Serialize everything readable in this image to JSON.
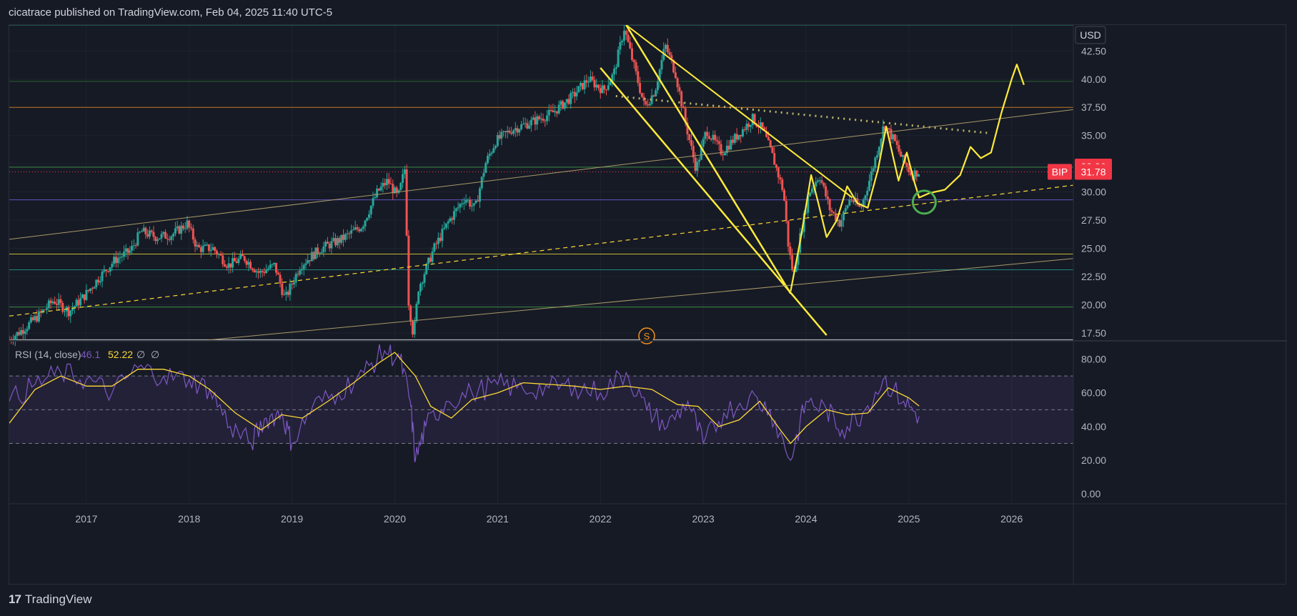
{
  "header": {
    "text": "cicatrace published on TradingView.com, Feb 04, 2025 11:40 UTC-5"
  },
  "footer": {
    "brand": "TradingView",
    "logo_glyph": "17"
  },
  "currency_label": "USD",
  "price_tags": [
    {
      "label": "32.26",
      "value": 32.26,
      "color": "#f23645"
    },
    {
      "label": "31.78",
      "value": 31.78,
      "color": "#f23645",
      "symbol": "BIP"
    }
  ],
  "event_marker": {
    "label": "S",
    "year": 2022.45,
    "color": "#f7931a"
  },
  "colors": {
    "background": "#161a25",
    "up": "#26a69a",
    "down": "#ef5350",
    "drawing_yellow": "#ffeb3b",
    "rsi": "#7e57c2",
    "rsi_ma": "#fdd835",
    "circle": "#4caf50"
  },
  "chart_data": [
    {
      "type": "candlestick",
      "symbol": "BIP",
      "currency": "USD",
      "x_axis": {
        "ticks": [
          "2017",
          "2018",
          "2019",
          "2020",
          "2021",
          "2022",
          "2023",
          "2024",
          "2025",
          "2026"
        ],
        "range": [
          2016.25,
          2026.6
        ]
      },
      "y_axis": {
        "ticks": [
          "17.50",
          "20.00",
          "22.50",
          "25.00",
          "27.50",
          "30.00",
          "32.50",
          "35.00",
          "37.50",
          "40.00",
          "42.50"
        ],
        "range": [
          16.8,
          44.8
        ]
      },
      "last_price": 31.78,
      "price_path": [
        [
          2016.25,
          16.8
        ],
        [
          2016.4,
          17.8
        ],
        [
          2016.55,
          19.0
        ],
        [
          2016.7,
          20.4
        ],
        [
          2016.85,
          19.4
        ],
        [
          2017.0,
          20.8
        ],
        [
          2017.15,
          22.5
        ],
        [
          2017.3,
          24.0
        ],
        [
          2017.45,
          24.8
        ],
        [
          2017.55,
          26.5
        ],
        [
          2017.7,
          26.0
        ],
        [
          2017.85,
          26.2
        ],
        [
          2018.0,
          27.2
        ],
        [
          2018.1,
          25.0
        ],
        [
          2018.25,
          25.0
        ],
        [
          2018.4,
          23.5
        ],
        [
          2018.55,
          24.2
        ],
        [
          2018.7,
          22.8
        ],
        [
          2018.85,
          23.5
        ],
        [
          2018.95,
          20.5
        ],
        [
          2019.1,
          23.5
        ],
        [
          2019.3,
          25.0
        ],
        [
          2019.5,
          25.8
        ],
        [
          2019.7,
          27.0
        ],
        [
          2019.85,
          30.0
        ],
        [
          2019.95,
          31.0
        ],
        [
          2020.05,
          29.5
        ],
        [
          2020.12,
          32.2
        ],
        [
          2020.15,
          20.5
        ],
        [
          2020.2,
          17.2
        ],
        [
          2020.25,
          21.5
        ],
        [
          2020.4,
          25.0
        ],
        [
          2020.55,
          27.5
        ],
        [
          2020.7,
          29.5
        ],
        [
          2020.8,
          28.5
        ],
        [
          2020.9,
          32.5
        ],
        [
          2021.0,
          34.5
        ],
        [
          2021.15,
          35.5
        ],
        [
          2021.35,
          36.2
        ],
        [
          2021.55,
          37.0
        ],
        [
          2021.75,
          38.5
        ],
        [
          2021.9,
          40.0
        ],
        [
          2022.05,
          39.0
        ],
        [
          2022.15,
          40.5
        ],
        [
          2022.25,
          44.5
        ],
        [
          2022.35,
          41.0
        ],
        [
          2022.45,
          37.5
        ],
        [
          2022.55,
          39.0
        ],
        [
          2022.65,
          43.0
        ],
        [
          2022.75,
          40.5
        ],
        [
          2022.85,
          36.0
        ],
        [
          2022.95,
          32.0
        ],
        [
          2023.05,
          35.5
        ],
        [
          2023.2,
          33.5
        ],
        [
          2023.35,
          35.0
        ],
        [
          2023.5,
          36.5
        ],
        [
          2023.6,
          35.5
        ],
        [
          2023.7,
          33.0
        ],
        [
          2023.8,
          30.0
        ],
        [
          2023.85,
          25.0
        ],
        [
          2023.9,
          22.5
        ],
        [
          2023.95,
          25.5
        ],
        [
          2024.05,
          30.0
        ],
        [
          2024.15,
          31.5
        ],
        [
          2024.25,
          28.5
        ],
        [
          2024.35,
          27.2
        ],
        [
          2024.45,
          29.5
        ],
        [
          2024.55,
          28.5
        ],
        [
          2024.65,
          31.5
        ],
        [
          2024.78,
          36.0
        ],
        [
          2024.88,
          34.5
        ],
        [
          2024.95,
          33.0
        ],
        [
          2025.05,
          31.5
        ],
        [
          2025.1,
          31.78
        ]
      ]
    },
    {
      "type": "line",
      "title": "RSI (14, close)",
      "series": [
        {
          "name": "RSI",
          "last": 46.1,
          "color": "#7e57c2",
          "x": [
            2016.25,
            2016.5,
            2016.75,
            2017.0,
            2017.25,
            2017.5,
            2017.75,
            2018.0,
            2018.2,
            2018.4,
            2018.6,
            2018.75,
            2018.9,
            2019.0,
            2019.2,
            2019.45,
            2019.7,
            2019.9,
            2020.05,
            2020.15,
            2020.2,
            2020.3,
            2020.5,
            2020.75,
            2021.0,
            2021.25,
            2021.5,
            2021.75,
            2022.0,
            2022.25,
            2022.45,
            2022.65,
            2022.85,
            2023.0,
            2023.2,
            2023.45,
            2023.65,
            2023.85,
            2024.0,
            2024.2,
            2024.35,
            2024.55,
            2024.75,
            2024.95,
            2025.1
          ],
          "values": [
            55,
            65,
            72,
            68,
            60,
            75,
            70,
            68,
            62,
            40,
            30,
            45,
            48,
            30,
            52,
            60,
            72,
            85,
            80,
            55,
            20,
            40,
            55,
            60,
            65,
            62,
            63,
            64,
            60,
            72,
            50,
            40,
            55,
            30,
            48,
            58,
            50,
            20,
            55,
            50,
            38,
            48,
            68,
            55,
            46.1
          ]
        },
        {
          "name": "RSI-based MA",
          "last": 52.22,
          "color": "#fdd835",
          "x": [
            2016.25,
            2016.5,
            2016.75,
            2017.0,
            2017.25,
            2017.5,
            2017.75,
            2018.0,
            2018.2,
            2018.45,
            2018.7,
            2018.9,
            2019.1,
            2019.35,
            2019.6,
            2019.85,
            2020.0,
            2020.2,
            2020.35,
            2020.55,
            2020.75,
            2021.0,
            2021.25,
            2021.5,
            2021.75,
            2022.0,
            2022.25,
            2022.5,
            2022.75,
            2022.95,
            2023.15,
            2023.35,
            2023.55,
            2023.75,
            2023.85,
            2024.0,
            2024.2,
            2024.4,
            2024.6,
            2024.8,
            2025.0,
            2025.1
          ],
          "values": [
            42,
            62,
            70,
            64,
            64,
            74,
            74,
            70,
            62,
            48,
            38,
            47,
            45,
            55,
            66,
            78,
            84,
            70,
            52,
            45,
            56,
            60,
            66,
            65,
            64,
            62,
            64,
            62,
            53,
            52,
            40,
            44,
            55,
            38,
            30,
            40,
            50,
            47,
            48,
            63,
            57,
            52.22
          ]
        }
      ],
      "y_axis": {
        "ticks": [
          "0.00",
          "20.00",
          "40.00",
          "60.00",
          "80.00"
        ],
        "range": [
          -5,
          90
        ]
      },
      "levels": [
        30,
        50,
        70
      ]
    }
  ]
}
